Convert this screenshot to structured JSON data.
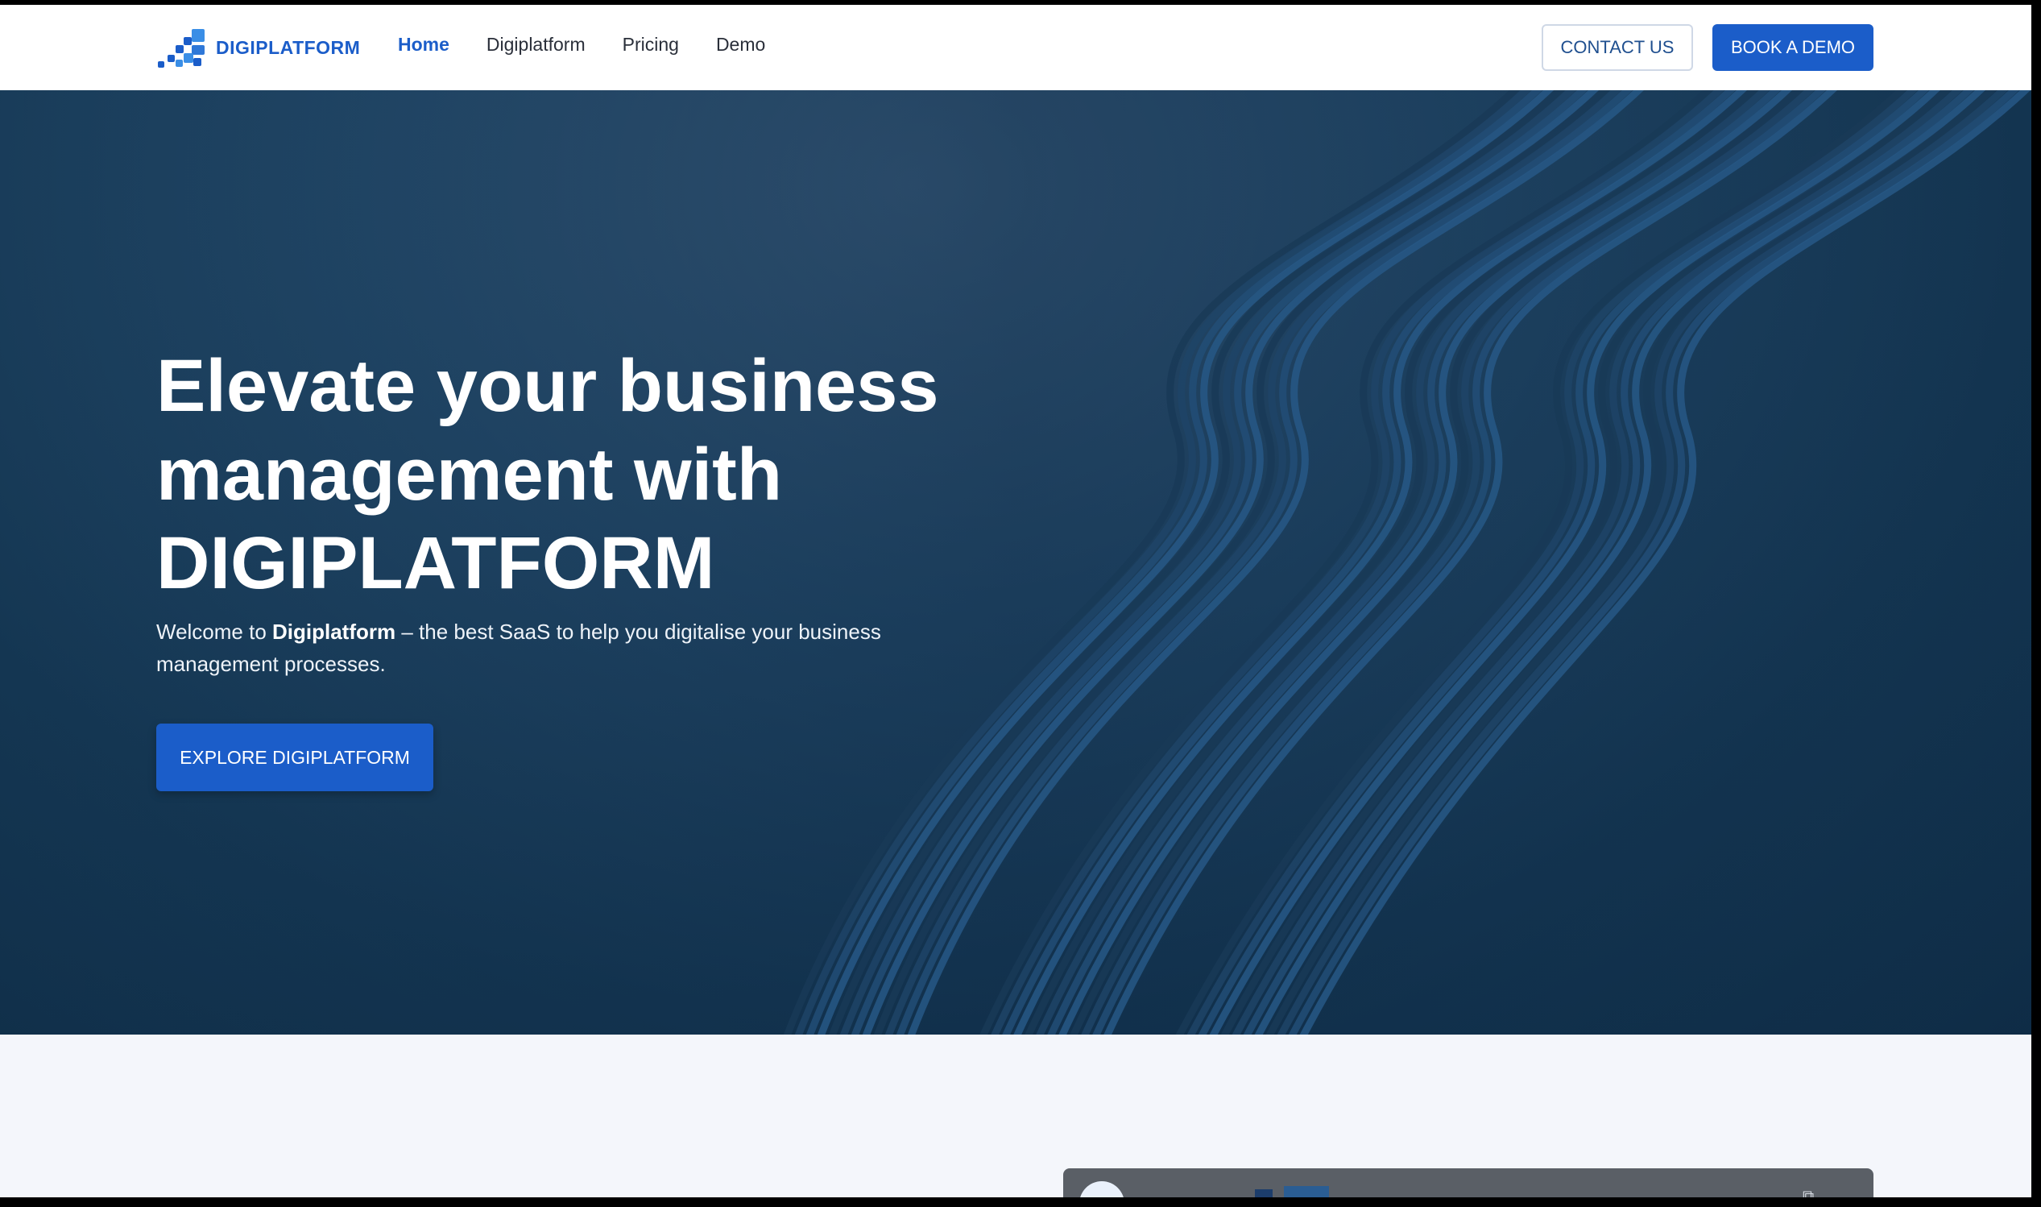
{
  "colors": {
    "brand_blue": "#1b5dc9",
    "brand_light": "#3a8ee6",
    "nav_active": "#1b5dc9",
    "contact_text": "#1f4f8f"
  },
  "header": {
    "logo_text": "DIGIPLATFORM",
    "nav": [
      {
        "label": "Home",
        "active": true
      },
      {
        "label": "Digiplatform",
        "active": false
      },
      {
        "label": "Pricing",
        "active": false
      },
      {
        "label": "Demo",
        "active": false
      }
    ],
    "contact_label": "CONTACT US",
    "book_label": "BOOK A DEMO"
  },
  "hero": {
    "title_lines": [
      "Elevate your business",
      "management with",
      "DIGIPLATFORM"
    ],
    "subtitle_prefix": "Welcome to ",
    "subtitle_brand": "Digiplatform",
    "subtitle_rest": " – the best SaaS to help you digitalise your business management processes.",
    "cta_label": "EXPLORE DIGIPLATFORM"
  },
  "preview": {
    "copy_icon": "copy-icon"
  }
}
